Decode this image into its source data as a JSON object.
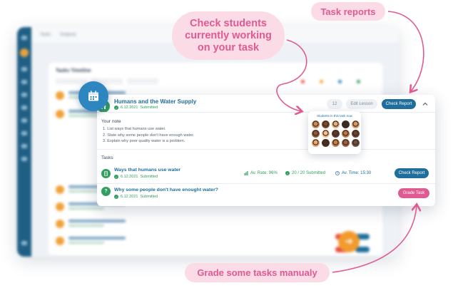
{
  "background_app": {
    "tabs": [
      "Tasks",
      "Subjects"
    ],
    "title": "Tasks Timeline"
  },
  "lesson": {
    "title": "Humans and the Water Supply",
    "date": "6.12.2021",
    "status": "Submitted",
    "count": "12",
    "edit_label": "Edit Lesson",
    "check_label": "Check Report"
  },
  "note": {
    "heading": "Your note",
    "items": [
      "1. List ways that humans use water.",
      "2. State why some people don't have enough water.",
      "3. Explain why poor quality water is a problem."
    ]
  },
  "tasks": {
    "heading": "Tasks",
    "items": [
      {
        "title": "Ways that humans use water",
        "date": "6.12.2021",
        "status": "Submitted",
        "avg_rate": "Av. Rate: 96%",
        "submitted": "20 / 20 Submitted",
        "avg_time": "Av. Time: 15:30",
        "button": "Check Report"
      },
      {
        "title": "Why some people don't have enought water?",
        "date": "6.12.2021",
        "status": "Submitted",
        "button": "Grade Task"
      }
    ]
  },
  "students_popup": {
    "title": "Students in this task now",
    "face_colors": [
      "#c98a5a",
      "#7a4a2e",
      "#e0b080",
      "#3b2a22",
      "#d59a6a",
      "#8a5a3a",
      "#f0c090",
      "#5a3a2a",
      "#b97a4a",
      "#6a4030",
      "#e5a575",
      "#4a3020",
      "#c08050",
      "#9a6040",
      "#705040"
    ]
  },
  "callouts": {
    "check_students": [
      "Check students",
      "currently working",
      "on your task"
    ],
    "task_reports": "Task reports",
    "grade_tasks": "Grade some tasks manualy"
  },
  "colors": {
    "primary": "#1f6e9b",
    "success": "#2f9e5f",
    "accent_pink": "#e05a92",
    "callout_bg": "#fadbe6"
  }
}
